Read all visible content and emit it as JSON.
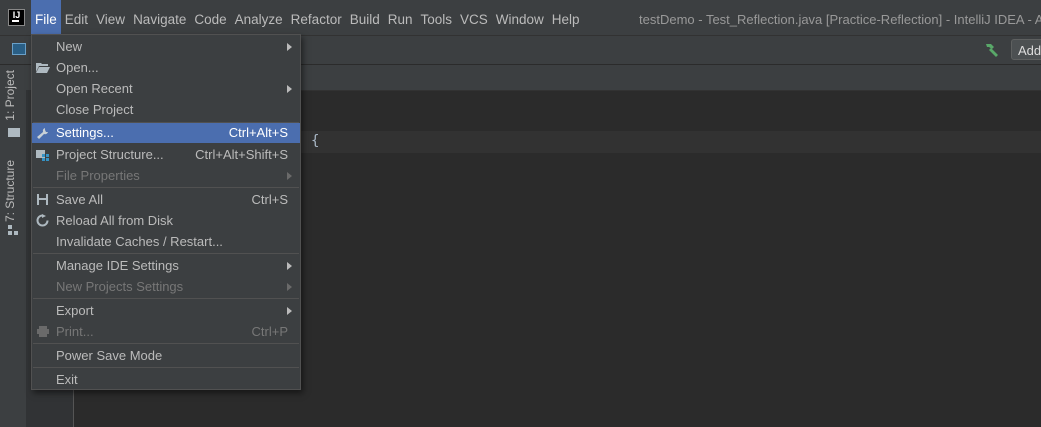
{
  "menubar": {
    "items": [
      "File",
      "Edit",
      "View",
      "Navigate",
      "Code",
      "Analyze",
      "Refactor",
      "Build",
      "Run",
      "Tools",
      "VCS",
      "Window",
      "Help"
    ],
    "active": "File"
  },
  "window_title": "testDemo - Test_Reflection.java [Practice-Reflection] - IntelliJ IDEA - A",
  "app_logo": "IJ",
  "toolbar": {
    "add_label": "Add"
  },
  "left_tabs": {
    "project": "1: Project",
    "structure": "7: Structure"
  },
  "editor": {
    "visible_code": "{"
  },
  "file_menu": {
    "new": "New",
    "open": "Open...",
    "open_recent": "Open Recent",
    "close_project": "Close Project",
    "settings": "Settings...",
    "settings_shortcut": "Ctrl+Alt+S",
    "project_structure": "Project Structure...",
    "project_structure_shortcut": "Ctrl+Alt+Shift+S",
    "file_properties": "File Properties",
    "save_all": "Save All",
    "save_all_shortcut": "Ctrl+S",
    "reload_all": "Reload All from Disk",
    "invalidate_caches": "Invalidate Caches / Restart...",
    "manage_ide_settings": "Manage IDE Settings",
    "new_projects_settings": "New Projects Settings",
    "export": "Export",
    "print": "Print...",
    "print_shortcut": "Ctrl+P",
    "power_save_mode": "Power Save Mode",
    "exit": "Exit"
  },
  "colors": {
    "selection": "#4b6eaf",
    "menu_bg": "#3c3f41",
    "editor_bg": "#2b2b2b",
    "hammer_green": "#59a869"
  }
}
